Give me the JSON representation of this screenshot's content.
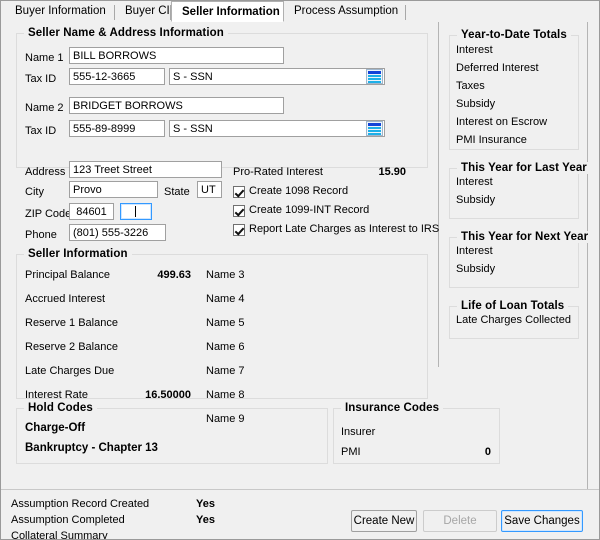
{
  "tabs": [
    {
      "label": "Buyer Information",
      "active": false
    },
    {
      "label": "Buyer CIF",
      "active": false
    },
    {
      "label": "Seller Information",
      "active": true
    },
    {
      "label": "Process Assumption",
      "active": false
    }
  ],
  "name_address_group": {
    "title": "Seller Name & Address Information",
    "fields": {
      "name1_label": "Name 1",
      "name1_value": "BILL BORROWS",
      "taxid1_label": "Tax ID",
      "taxid1_value": "555-12-3665",
      "taxid1_type": "S - SSN",
      "name2_label": "Name 2",
      "name2_value": "BRIDGET BORROWS",
      "taxid2_label": "Tax ID",
      "taxid2_value": "555-89-8999",
      "taxid2_type": "S - SSN",
      "address_label": "Address",
      "address_value": "123 Treet Street",
      "city_label": "City",
      "city_value": "Provo",
      "state_label": "State",
      "state_value": "UT",
      "zip_label": "ZIP Code",
      "zip_value": "84601",
      "zip4_value": "",
      "phone_label": "Phone",
      "phone_value": "(801) 555-3226"
    },
    "prorated": {
      "label": "Pro-Rated Interest",
      "value": "15.90"
    },
    "checkboxes": [
      {
        "label": "Create 1098 Record",
        "checked": true
      },
      {
        "label": "Create 1099-INT Record",
        "checked": true
      },
      {
        "label": "Report Late Charges as Interest to IRS",
        "checked": true
      }
    ]
  },
  "seller_info_group": {
    "title": "Seller Information",
    "left_rows": [
      {
        "label": "Principal Balance",
        "value": "499.63"
      },
      {
        "label": "Accrued Interest",
        "value": ""
      },
      {
        "label": "Reserve 1 Balance",
        "value": ""
      },
      {
        "label": "Reserve 2 Balance",
        "value": ""
      },
      {
        "label": "Late Charges Due",
        "value": ""
      },
      {
        "label": "Interest Rate",
        "value": "16.50000"
      }
    ],
    "right_rows": [
      {
        "label": "Name 3",
        "value": ""
      },
      {
        "label": "Name 4",
        "value": ""
      },
      {
        "label": "Name 5",
        "value": ""
      },
      {
        "label": "Name 6",
        "value": ""
      },
      {
        "label": "Name 7",
        "value": ""
      },
      {
        "label": "Name 8",
        "value": ""
      },
      {
        "label": "Name 9",
        "value": ""
      }
    ]
  },
  "hold_codes_group": {
    "title": "Hold Codes",
    "items": [
      {
        "label": "Charge-Off",
        "bold": true
      },
      {
        "label": "Bankruptcy - Chapter 13",
        "bold": true
      }
    ]
  },
  "insurance_codes_group": {
    "title": "Insurance Codes",
    "rows": [
      {
        "label": "Insurer",
        "value": ""
      },
      {
        "label": "PMI",
        "value": "0"
      }
    ]
  },
  "right_panel": {
    "groups": [
      {
        "title": "Year-to-Date Totals",
        "rows": [
          {
            "label": "Interest",
            "value": ""
          },
          {
            "label": "Deferred Interest",
            "value": ""
          },
          {
            "label": "Taxes",
            "value": ""
          },
          {
            "label": "Subsidy",
            "value": ""
          },
          {
            "label": "Interest on Escrow",
            "value": ""
          },
          {
            "label": "PMI Insurance",
            "value": ""
          }
        ]
      },
      {
        "title": "This Year for Last Year",
        "rows": [
          {
            "label": "Interest",
            "value": ""
          },
          {
            "label": "Subsidy",
            "value": ""
          }
        ]
      },
      {
        "title": "This Year for Next Year",
        "rows": [
          {
            "label": "Interest",
            "value": ""
          },
          {
            "label": "Subsidy",
            "value": ""
          }
        ]
      },
      {
        "title": "Life of Loan Totals",
        "rows": [
          {
            "label": "Late Charges Collected",
            "value": ""
          }
        ]
      }
    ]
  },
  "status": {
    "rows": [
      {
        "label": "Assumption Record Created",
        "value": "Yes"
      },
      {
        "label": "Assumption Completed",
        "value": "Yes"
      },
      {
        "label": "Collateral Summary",
        "value": ""
      }
    ]
  },
  "buttons": {
    "create_new": "Create New",
    "delete": "Delete",
    "save_changes": "Save Changes"
  },
  "colors": {
    "window_bg": "#f0f0f0",
    "field_bg": "#ffffff",
    "focus_blue": "#3399ff",
    "group_border": "#dcdcdc",
    "lookup_header": "#1344d8",
    "lookup_rows": "#1db0e8"
  }
}
